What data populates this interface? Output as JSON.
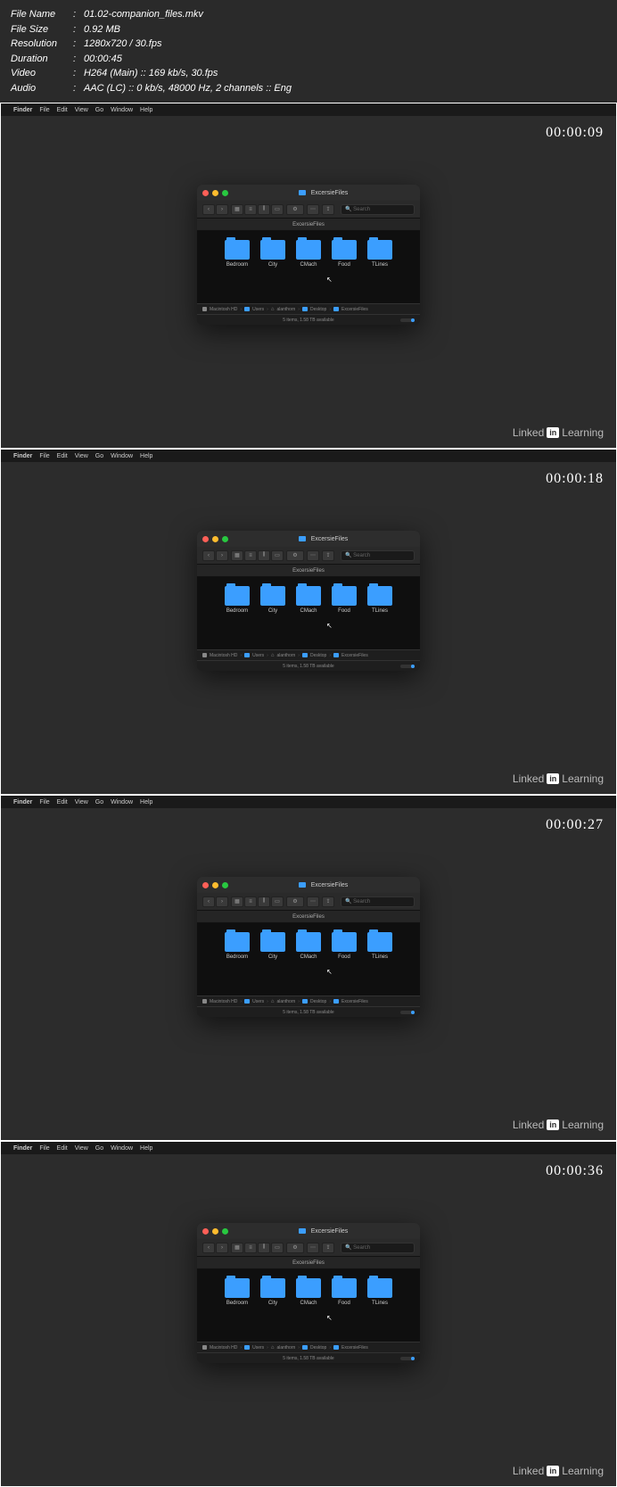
{
  "meta": {
    "filename_label": "File Name",
    "filename": "01.02-companion_files.mkv",
    "filesize_label": "File Size",
    "filesize": "0.92 MB",
    "resolution_label": "Resolution",
    "resolution": "1280x720 / 30.fps",
    "duration_label": "Duration",
    "duration": "00:00:45",
    "video_label": "Video",
    "video": "H264 (Main) :: 169 kb/s, 30.fps",
    "audio_label": "Audio",
    "audio": "AAC (LC) :: 0 kb/s, 48000 Hz, 2 channels :: Eng"
  },
  "menubar": {
    "app": "Finder",
    "items": [
      "File",
      "Edit",
      "View",
      "Go",
      "Window",
      "Help"
    ]
  },
  "frames": [
    {
      "timestamp": "00:00:09"
    },
    {
      "timestamp": "00:00:18"
    },
    {
      "timestamp": "00:00:27"
    },
    {
      "timestamp": "00:00:36"
    }
  ],
  "finder": {
    "title": "ExcersieFiles",
    "tab": "ExcersieFiles",
    "search_placeholder": "Search",
    "folders": [
      "Bedroom",
      "City",
      "CMach",
      "Food",
      "TLines"
    ],
    "path": [
      "Macintosh HD",
      "Users",
      "alanthorn",
      "Desktop",
      "ExcersieFiles"
    ],
    "status": "5 items, 1.58 TB available"
  },
  "watermark": {
    "brand": "Linked",
    "badge": "in",
    "product": "Learning"
  }
}
